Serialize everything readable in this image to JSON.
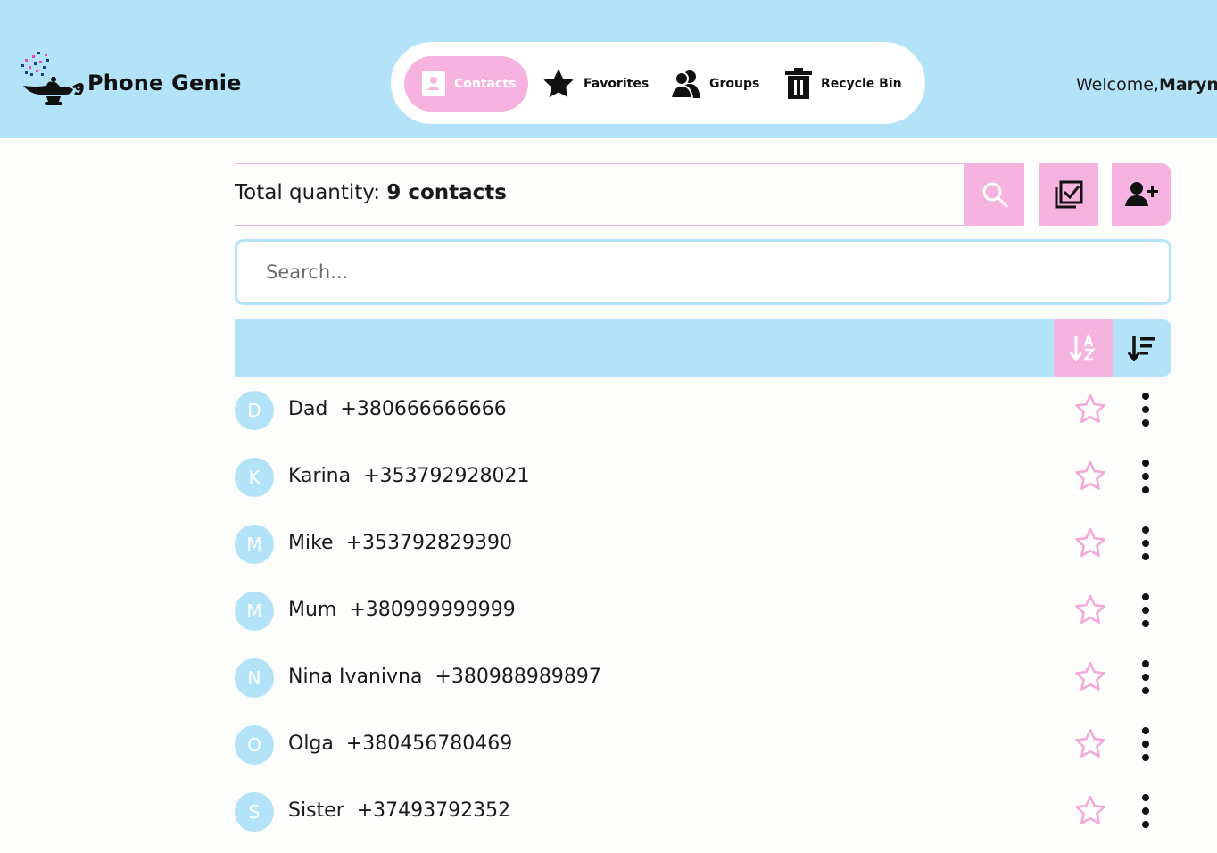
{
  "app": {
    "name": "Phone Genie",
    "welcome_prefix": "Welcome,",
    "user_name": "Maryn"
  },
  "nav": {
    "contacts": "Contacts",
    "favorites": "Favorites",
    "groups": "Groups",
    "recycle_bin": "Recycle Bin"
  },
  "toolbar": {
    "total_label": "Total quantity:",
    "total_value": "9 contacts"
  },
  "search": {
    "placeholder": "Search..."
  },
  "contacts": [
    {
      "initial": "D",
      "name": "Dad",
      "phone": "+380666666666"
    },
    {
      "initial": "K",
      "name": "Karina",
      "phone": "+353792928021"
    },
    {
      "initial": "M",
      "name": "Mike",
      "phone": "+353792829390"
    },
    {
      "initial": "M",
      "name": "Mum",
      "phone": "+380999999999"
    },
    {
      "initial": "N",
      "name": "Nina Ivanivna",
      "phone": "+380988989897"
    },
    {
      "initial": "O",
      "name": "Olga",
      "phone": "+380456780469"
    },
    {
      "initial": "S",
      "name": "Sister",
      "phone": "+37493792352"
    }
  ],
  "colors": {
    "header_bg": "#b3e3f8",
    "accent_pink": "#f6b3df",
    "star_outline": "#f3a8d8"
  },
  "icons": {
    "logo": "magic-lamp-icon",
    "contacts": "contact-book-icon",
    "favorites": "star-icon",
    "groups": "users-icon",
    "recycle_bin": "trash-icon",
    "search": "search-icon",
    "select": "checkbox-multi-icon",
    "add": "add-user-icon",
    "sort_alpha": "sort-alpha-icon",
    "sort_order": "sort-desc-icon",
    "favorite": "star-outline-icon",
    "more": "more-vertical-icon"
  }
}
